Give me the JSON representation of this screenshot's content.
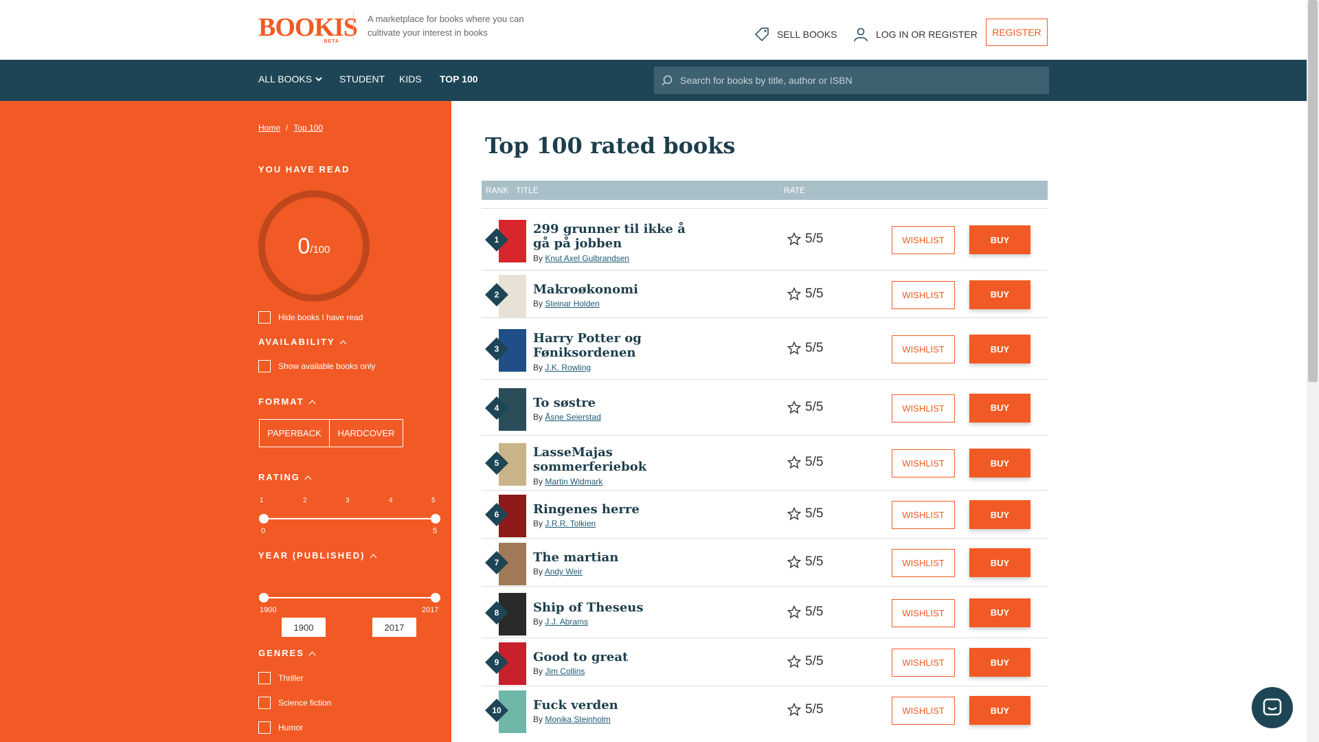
{
  "header": {
    "logo_text": "BOOKIS",
    "logo_badge": "BETA",
    "tagline": "A marketplace for books where you can cultivate your interest in books",
    "sell_label": "SELL BOOKS",
    "login_label": "LOG IN OR REGISTER",
    "register_label": "REGISTER"
  },
  "nav": {
    "items": [
      {
        "label": "ALL BOOKS"
      },
      {
        "label": "STUDENT"
      },
      {
        "label": "KIDS"
      },
      {
        "label": "TOP 100"
      }
    ],
    "search_placeholder": "Search for books by title, author or ISBN"
  },
  "sidebar": {
    "breadcrumb": [
      "Home",
      "Top 100"
    ],
    "breadcrumb_sep": "/",
    "you_have_read": "YOU HAVE READ",
    "read_count": "0",
    "read_total": "/100",
    "read_fraction": 0,
    "hide_read": "Hide books I have read",
    "availability": "AVAILABILITY",
    "show_available": "Show available books only",
    "format": "FORMAT",
    "format_options": [
      "PAPERBACK",
      "HARDCOVER"
    ],
    "rating": "RATING",
    "rating_ticks": [
      "1",
      "2",
      "3",
      "4",
      "5"
    ],
    "rating_min": "0",
    "rating_max": "5",
    "year": "YEAR (PUBLISHED)",
    "year_min": "1900",
    "year_max": "2017",
    "genres": "GENRES",
    "genre_items": [
      "Thriller",
      "Science fiction",
      "Humor"
    ]
  },
  "main": {
    "title": "Top 100 rated books",
    "columns": {
      "rank": "RANK",
      "title": "TITLE",
      "rate": "RATE"
    },
    "wishlist_label": "WISHLIST",
    "buy_label": "BUY",
    "by_label": "By",
    "books": [
      {
        "rank": "1",
        "title": "299 grunner til ikke å gå på jobben",
        "author": "Knut Axel Gulbrandsen",
        "rating": "5/5",
        "cover": "#d8262c"
      },
      {
        "rank": "2",
        "title": "Makroøkonomi",
        "author": "Steinar Holden",
        "rating": "5/5",
        "cover": "#e8e2d6"
      },
      {
        "rank": "3",
        "title": "Harry Potter og Føniksordenen",
        "author": "J.K. Rowling",
        "rating": "5/5",
        "cover": "#1f4f86"
      },
      {
        "rank": "4",
        "title": "To søstre",
        "author": "Åsne Seierstad",
        "rating": "5/5",
        "cover": "#2b4d5a"
      },
      {
        "rank": "5",
        "title": "LasseMajas sommerferiebok",
        "author": "Martin Widmark",
        "rating": "5/5",
        "cover": "#c9b48a"
      },
      {
        "rank": "6",
        "title": "Ringenes herre",
        "author": "J.R.R. Tolkien",
        "rating": "5/5",
        "cover": "#8e1a1a"
      },
      {
        "rank": "7",
        "title": "The martian",
        "author": "Andy Weir",
        "rating": "5/5",
        "cover": "#a07a57"
      },
      {
        "rank": "8",
        "title": "Ship of Theseus",
        "author": "J.J. Abrams",
        "rating": "5/5",
        "cover": "#2a2a2a"
      },
      {
        "rank": "9",
        "title": "Good to great",
        "author": "Jim Collins",
        "rating": "5/5",
        "cover": "#c8202c"
      },
      {
        "rank": "10",
        "title": "Fuck verden",
        "author": "Monika Steinholm",
        "rating": "5/5",
        "cover": "#6fb7a8"
      }
    ]
  },
  "colors": {
    "accent": "#f15a24",
    "navy": "#1d4555",
    "table_header": "#a8bfc7"
  }
}
